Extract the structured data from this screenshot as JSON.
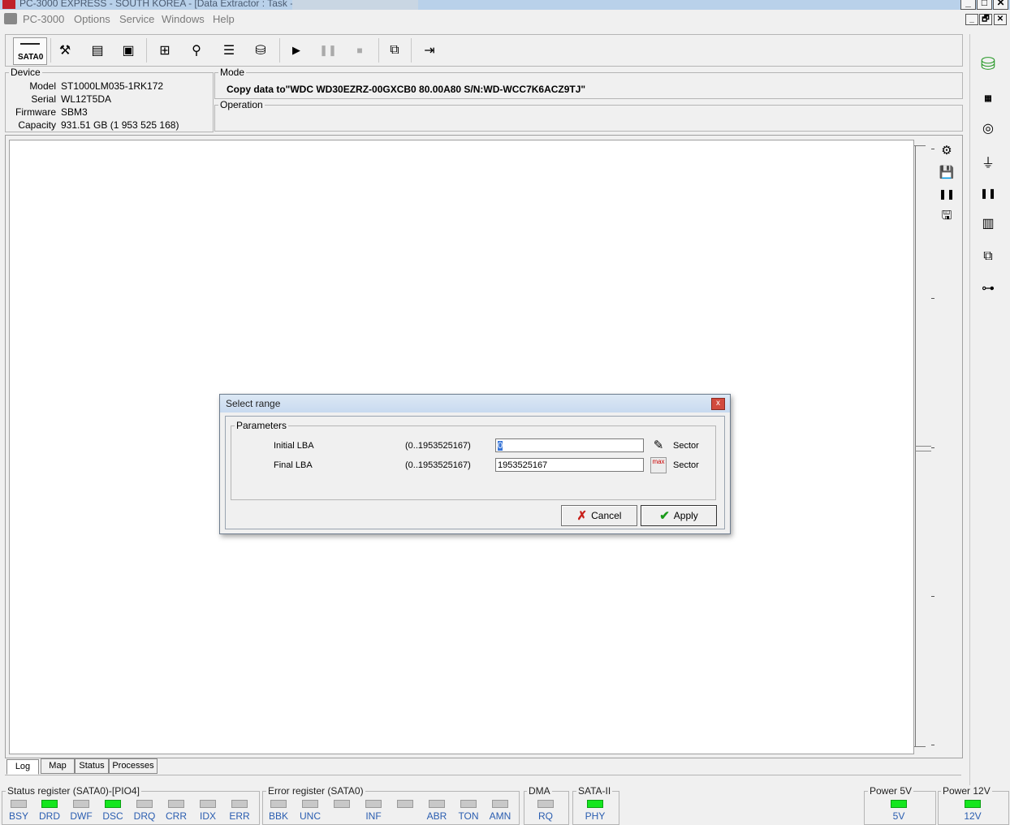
{
  "window": {
    "title": "PC-3000 EXPRESS - SOUTH KOREA - [Data Extractor : Task -",
    "min_label": "_",
    "max_label": "□",
    "close_label": "✕",
    "restore_label": "🗗"
  },
  "menu": [
    "PC-3000",
    "Options",
    "Service",
    "Windows",
    "Help"
  ],
  "toolbar": {
    "port_label": "SATA0",
    "icons": [
      "tools-icon",
      "sector-editor-icon",
      "id-icon",
      "percent-icon",
      "tree-icon",
      "search-icon",
      "stack-icon",
      "disk-icon",
      "play-icon",
      "pause-icon",
      "stop-icon",
      "copy-icon",
      "exit-icon"
    ]
  },
  "device": {
    "group_title": "Device",
    "model_label": "Model",
    "model": "ST1000LM035-1RK172",
    "serial_label": "Serial",
    "serial": "WL12T5DA",
    "firmware_label": "Firmware",
    "firmware": "SBM3",
    "capacity_label": "Capacity",
    "capacity": "931.51 GB (1 953 525 168)"
  },
  "mode": {
    "group_title": "Mode",
    "text": "Copy data to\"WDC WD30EZRZ-00GXCB0 80.00A80 S/N:WD-WCC7K6ACZ9TJ\""
  },
  "operation": {
    "group_title": "Operation"
  },
  "tabs": [
    "Log",
    "Map",
    "Status",
    "Processes"
  ],
  "dialog": {
    "title": "Select range",
    "close_label": "x",
    "group_title": "Parameters",
    "initial_label": "Initial LBA",
    "initial_range": "(0..1953525167)",
    "initial_value": "0",
    "final_label": "Final  LBA",
    "final_range": "(0..1953525167)",
    "final_value": "1953525167",
    "unit": "Sector",
    "max_icon_label": "max",
    "cancel_label": "Cancel",
    "apply_label": "Apply"
  },
  "status_register": {
    "title": "Status register (SATA0)-[PIO4]",
    "leds": [
      {
        "label": "BSY",
        "on": false
      },
      {
        "label": "DRD",
        "on": true
      },
      {
        "label": "DWF",
        "on": false
      },
      {
        "label": "DSC",
        "on": true
      },
      {
        "label": "DRQ",
        "on": false
      },
      {
        "label": "CRR",
        "on": false
      },
      {
        "label": "IDX",
        "on": false
      },
      {
        "label": "ERR",
        "on": false
      }
    ]
  },
  "error_register": {
    "title": "Error register (SATA0)",
    "leds": [
      {
        "label": "BBK",
        "on": false
      },
      {
        "label": "UNC",
        "on": false
      },
      {
        "label": "",
        "on": false
      },
      {
        "label": "INF",
        "on": false
      },
      {
        "label": "",
        "on": false
      },
      {
        "label": "ABR",
        "on": false
      },
      {
        "label": "TON",
        "on": false
      },
      {
        "label": "AMN",
        "on": false
      }
    ]
  },
  "dma": {
    "title": "DMA",
    "label": "RQ",
    "on": false
  },
  "sata2": {
    "title": "SATA-II",
    "label": "PHY",
    "on": true
  },
  "power5": {
    "title": "Power 5V",
    "label": "5V",
    "on": true
  },
  "power12": {
    "title": "Power 12V",
    "label": "12V",
    "on": true
  },
  "colors": {
    "led_on": "#14e61e",
    "led_off": "#c8c8c8",
    "title_bar": "#b9d1ea",
    "cancel_x": "#c8201a",
    "apply_check": "#1a9a1a"
  }
}
